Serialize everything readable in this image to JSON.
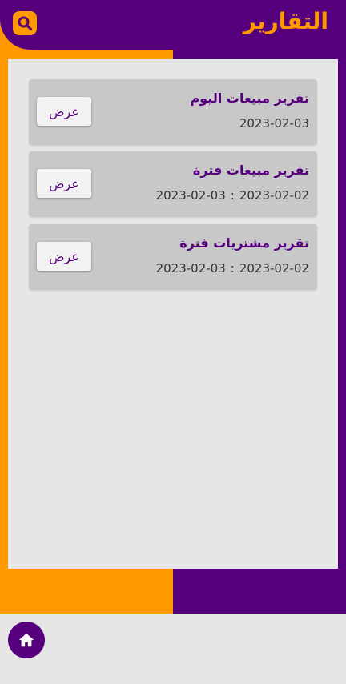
{
  "header": {
    "title": "التقارير",
    "search_icon": "search-icon"
  },
  "reports": [
    {
      "title": "تقرير مبيعات اليوم",
      "date_from": "",
      "separator": "",
      "date_to": "2023-02-03",
      "button": "عرض"
    },
    {
      "title": "تقرير مبيعات فترة",
      "date_from": "2023-02-03",
      "separator": ":",
      "date_to": "2023-02-02",
      "button": "عرض"
    },
    {
      "title": "تقرير مشتريات فترة",
      "date_from": "2023-02-03",
      "separator": ":",
      "date_to": "2023-02-02",
      "button": "عرض"
    }
  ],
  "footer": {
    "home_icon": "home-icon"
  },
  "colors": {
    "primary": "#57007e",
    "accent": "#ff9900",
    "card": "#c8c8c8",
    "background": "#e6e6e6"
  }
}
